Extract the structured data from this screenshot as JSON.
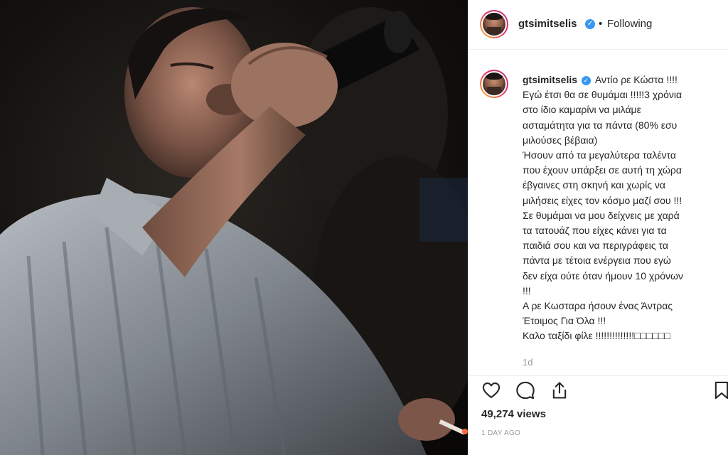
{
  "header": {
    "username": "gtsimitselis",
    "separator": "•",
    "follow_status": "Following"
  },
  "caption": {
    "username": "gtsimitselis",
    "lines": [
      "Αντίο ρε Κώστα !!!!",
      "Εγώ έτσι θα σε θυμάμαι !!!!!3 χρόνια",
      "στο ίδιο καμαρίνι να μιλάμε",
      "ασταμάτητα για τα πάντα (80% εσυ",
      "μιλούσες βέβαια)",
      "Ήσουν από τα μεγαλύτερα ταλέντα",
      "που έχουν υπάρξει σε αυτή τη χώρα",
      "έβγαινες στη σκηνή και χωρίς να",
      "μιλήσεις είχες τον κόσμο μαζί σου !!!",
      "Σε θυμάμαι να μου δείχνεις με χαρά",
      "τα τατουάζ που είχες κάνει για τα",
      "παιδιά σου και να περιγράφεις τα",
      "πάντα με τέτοια ενέργεια που εγώ",
      "δεν είχα ούτε όταν ήμουν 10 χρόνων",
      "!!!",
      "Α ρε Κωσταρα ήσουν ένας Άντρας",
      "Έτοιμος Για Όλα !!!",
      "Καλο ταξίδι φίλε !!!!!!!!!!!!!!□□□□□□"
    ],
    "age": "1d"
  },
  "actions": {
    "like_icon": "heart-icon",
    "comment_icon": "comment-icon",
    "share_icon": "share-icon",
    "save_icon": "bookmark-icon"
  },
  "stats": {
    "views": "49,274 views",
    "timestamp": "1 DAY AGO"
  },
  "colors": {
    "verified": "#3897f0",
    "text": "#262626",
    "muted": "#999999",
    "divider": "#efefef"
  }
}
